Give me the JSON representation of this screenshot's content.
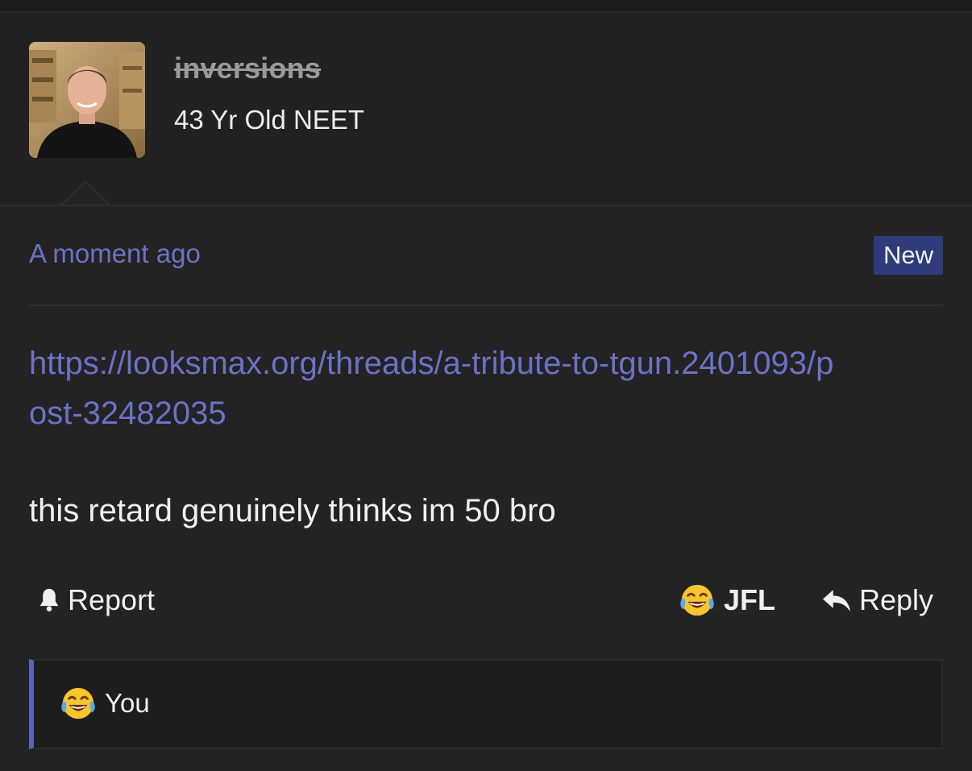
{
  "user": {
    "username": "inversions",
    "title": "43 Yr Old NEET"
  },
  "post": {
    "timestamp": "A moment ago",
    "badge": "New",
    "link": "https://looksmax.org/threads/a-tribute-to-tgun.2401093/post-32482035",
    "text": "this retard genuinely thinks im 50 bro"
  },
  "actions": {
    "report_label": "Report",
    "reaction_label": "JFL",
    "reply_label": "Reply"
  },
  "reactions": {
    "summary_label": "You"
  },
  "icons": {
    "report": "bell-icon",
    "reaction": "crying-laughing-emoji-icon",
    "reply": "reply-arrow-icon"
  },
  "colors": {
    "accent": "#6b72c7",
    "badge_bg": "#2f3b7a",
    "background": "#232323"
  }
}
